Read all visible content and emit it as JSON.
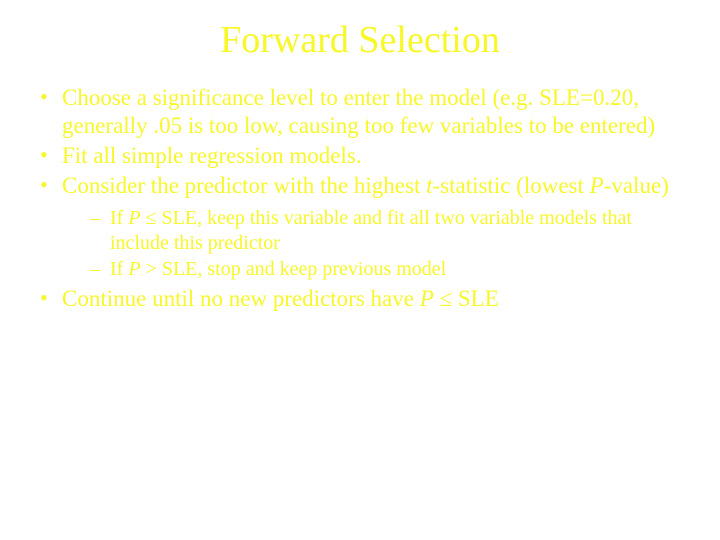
{
  "title": "Forward Selection",
  "bullets": {
    "b1": "Choose a significance level to enter the model (e.g. SLE=0.20, generally .05 is too low, causing too few variables to be entered)",
    "b2": "Fit all simple regression models.",
    "b3_pre": "Consider the predictor with the highest ",
    "b3_it1": "t",
    "b3_mid": "-statistic (lowest ",
    "b3_it2": "P",
    "b3_post": "-value)",
    "s1_pre": "If ",
    "s1_it": "P",
    "s1_post": " ≤ SLE, keep this variable and fit all two variable models that include this predictor",
    "s2_pre": "If ",
    "s2_it": "P",
    "s2_post": " > SLE, stop and keep previous model",
    "b4_pre": "Continue until no new predictors have ",
    "b4_it": "P",
    "b4_post": " ≤ SLE"
  }
}
